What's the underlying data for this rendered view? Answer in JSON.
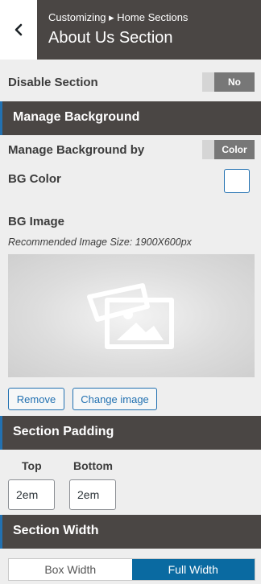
{
  "header": {
    "breadcrumb": "Customizing ▸ Home Sections",
    "title": "About Us Section",
    "back_icon": "chevron-left-icon"
  },
  "disable_section": {
    "label": "Disable Section",
    "value": "No"
  },
  "manage_background": {
    "section_title": "Manage Background",
    "by_label": "Manage Background by",
    "by_value": "Color",
    "bg_color_label": "BG Color",
    "bg_color_value": "#ffffff",
    "bg_image_label": "BG Image",
    "recommended_size": "Recommended Image Size: 1900X600px",
    "image_icon": "image-placeholder-icon",
    "remove_label": "Remove",
    "change_label": "Change image"
  },
  "section_padding": {
    "section_title": "Section Padding",
    "top_label": "Top",
    "top_value": "2em",
    "bottom_label": "Bottom",
    "bottom_value": "2em"
  },
  "section_width": {
    "section_title": "Section Width",
    "options": [
      "Box Width",
      "Full Width"
    ],
    "selected": "Full Width"
  },
  "colors": {
    "header_bg": "#4a4644",
    "accent": "#2271b1",
    "selected_segment": "#0a6aa1",
    "panel_bg": "#eeeeee"
  }
}
